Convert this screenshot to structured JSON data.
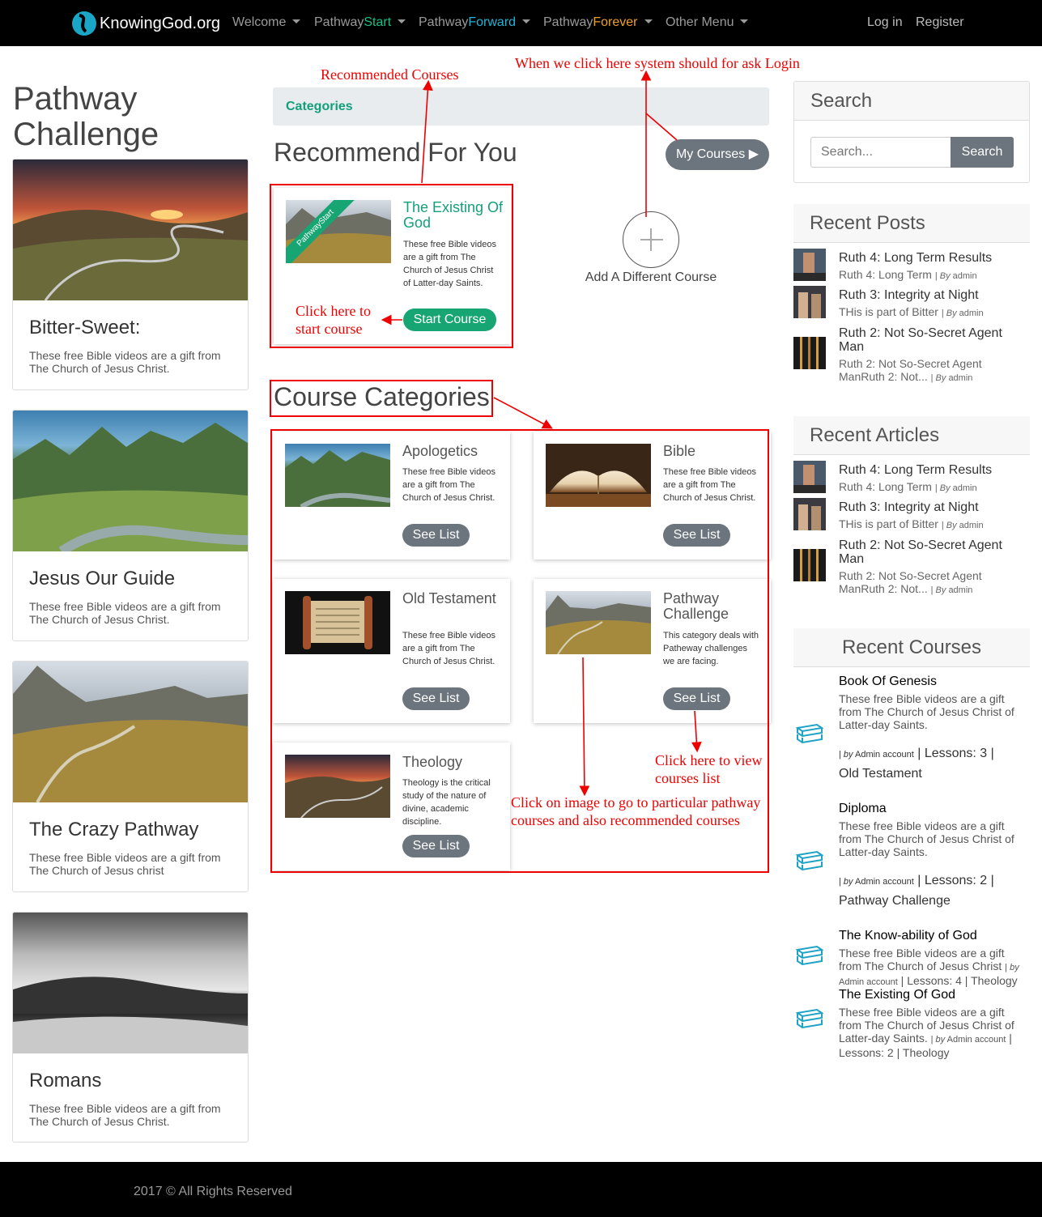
{
  "nav": {
    "brand": "KnowingGod.org",
    "items": [
      {
        "prefix": "Welcome",
        "suffix": "",
        "color": "#9a9a9a"
      },
      {
        "prefix": "Pathway",
        "suffix": "Start",
        "color": "#17c08a"
      },
      {
        "prefix": "Pathway",
        "suffix": "Forward",
        "color": "#1fb5d6"
      },
      {
        "prefix": "Pathway",
        "suffix": "Forever",
        "color": "#f0a020"
      },
      {
        "prefix": "Other Menu",
        "suffix": "",
        "color": "#9a9a9a"
      }
    ],
    "login": "Log in",
    "register": "Register"
  },
  "left": {
    "title": "Pathway Challenge",
    "posts": [
      {
        "title": "Bitter-Sweet:",
        "desc": "These free Bible videos are a gift from The Church of Jesus Christ."
      },
      {
        "title": "Jesus Our Guide",
        "desc": "These free Bible videos are a gift from The Church of Jesus Christ."
      },
      {
        "title": "The Crazy Pathway",
        "desc": "These free Bible videos are a gift from The Church of Jesus christ"
      },
      {
        "title": "Romans",
        "desc": "These free Bible videos are a gift from The Church of Jesus Christ."
      }
    ]
  },
  "center": {
    "categories_bar": "Categories",
    "recommend_heading": "Recommend For You",
    "my_courses": "My Courses ▶",
    "add_course": "Add A Different Course",
    "recommended": {
      "ribbon": "PathwayStart",
      "title": "The Existing Of God",
      "desc": "These free Bible videos are a gift from The Church of Jesus Christ of Latter-day Saints.",
      "button": "Start Course"
    },
    "categories_heading": "Course Categories",
    "categories": [
      {
        "title": "Apologetics",
        "desc": "These free Bible videos are a gift from The Church of Jesus Christ.",
        "button": "See List"
      },
      {
        "title": "Bible",
        "desc": "These free Bible videos are a gift from The Church of Jesus Christ.",
        "button": "See List"
      },
      {
        "title": "Old Testament",
        "desc": "These free Bible videos are a gift from The Church of Jesus Christ.",
        "button": "See List"
      },
      {
        "title": "Pathway Challenge",
        "desc": "This category deals with Patheway challenges we are facing.",
        "button": "See List"
      },
      {
        "title": "Theology",
        "desc": "Theology is the critical study of the nature of divine, academic discipline.",
        "button": "See List"
      }
    ]
  },
  "annotations": {
    "recommended_courses": "Recommended  Courses",
    "login_note": "When we click here system should for ask Login",
    "start_note": "Click here to start course",
    "view_note": "Click here to view courses list",
    "image_note": "Click on image to go to particular pathway courses and also recommended courses"
  },
  "sidebar": {
    "search": {
      "heading": "Search",
      "placeholder": "Search...",
      "button": "Search"
    },
    "recent_posts": {
      "heading": "Recent Posts",
      "items": [
        {
          "title": "Ruth 4: Long Term Results",
          "desc": "Ruth 4: Long Term",
          "by": "By",
          "author": "admin"
        },
        {
          "title": "Ruth 3: Integrity at Night",
          "desc": "THis is part of Bitter",
          "by": "By",
          "author": "admin"
        },
        {
          "title": "Ruth 2: Not So-Secret Agent Man",
          "desc": "Ruth 2: Not So-Secret Agent ManRuth 2: Not...",
          "by": "By",
          "author": "admin"
        }
      ]
    },
    "recent_articles": {
      "heading": "Recent Articles",
      "items": [
        {
          "title": "Ruth 4: Long Term Results",
          "desc": "Ruth 4: Long Term",
          "by": "By",
          "author": "admin"
        },
        {
          "title": "Ruth 3: Integrity at Night",
          "desc": "THis is part of Bitter",
          "by": "By",
          "author": "admin"
        },
        {
          "title": "Ruth 2: Not So-Secret Agent Man",
          "desc": "Ruth 2: Not So-Secret Agent ManRuth 2: Not...",
          "by": "By",
          "author": "admin"
        }
      ]
    },
    "recent_courses": {
      "heading": "Recent Courses",
      "items": [
        {
          "title": "Book Of Genesis",
          "desc": "These free Bible videos are a gift from The Church of Jesus Christ of Latter-day Saints.",
          "by": "by",
          "author": "Admin account",
          "lessons": "Lessons: 3",
          "category": "Old Testament"
        },
        {
          "title": "Diploma",
          "desc": "These free Bible videos are a gift from The Church of Jesus Christ of Latter-day Saints.",
          "by": "by",
          "author": "Admin account",
          "lessons": "Lessons: 2",
          "category": "Pathway Challenge"
        },
        {
          "title": "The Know-ability of God",
          "desc": "These free Bible videos are a gift from The Church of Jesus Christ",
          "by": "by",
          "author": "Admin account",
          "lessons": "Lessons: 4",
          "category": "Theology"
        },
        {
          "title": "The Existing Of God",
          "desc": "These free Bible videos are a gift from The Church of Jesus Christ of Latter-day Saints.",
          "by": "by",
          "author": "Admin account",
          "lessons": "Lessons: 2",
          "category": "Theology"
        }
      ]
    }
  },
  "footer": "2017 © All Rights Reserved"
}
